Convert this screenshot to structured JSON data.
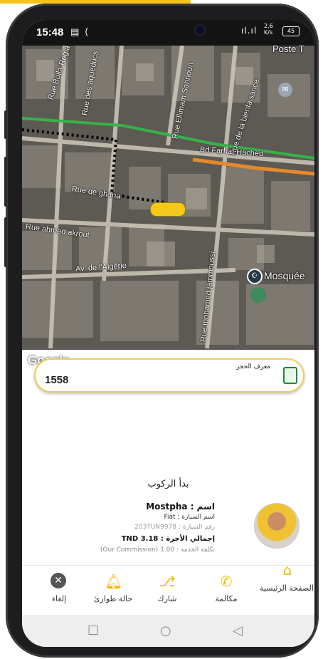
{
  "status_bar": {
    "time": "15:48",
    "signal": "ıl.ıl",
    "speed_value": "2,6",
    "speed_unit": "K/s",
    "battery": "45"
  },
  "map": {
    "streets": [
      "Rue Bulla Regia",
      "Rue des aqueducs",
      "Rue Ellimam Sahnoun",
      "Rue de la bienfaisance",
      "Bd Farhat Hached",
      "Rue de ghana",
      "Rue ahmed akrout",
      "Av. de l'Algérie",
      "Rue mohamed jammoussi",
      "Mosquée",
      "Poste T"
    ],
    "attribution": "Google",
    "colors": {
      "route_green": "#36b24a",
      "route_orange": "#e58a2c",
      "path_dots": "#000000",
      "taxi": "#f4c81c"
    }
  },
  "booking": {
    "label": "معرف الحجز",
    "value": "1558",
    "icon": "id-card-icon"
  },
  "ride": {
    "title": "بدأ الركوب",
    "name_label": "اسم :",
    "name_value": "Mostpha",
    "car_label": "اسم السيارة :",
    "car_value": "Fiat",
    "plate_label": "رقم السيارة :",
    "plate_value": "203TUN9978",
    "fare_label": "إجمالي الأجرة :",
    "fare_value": "TND 3.18",
    "fee_label": "تكلفة الخدمة :",
    "fee_value": "1.00",
    "commission": "(Our Commission)"
  },
  "nav": {
    "items": [
      {
        "label": "إلغاء",
        "icon": "cancel-icon"
      },
      {
        "label": "حالة طوارئ",
        "icon": "bell-icon"
      },
      {
        "label": "شارك",
        "icon": "share-icon"
      },
      {
        "label": "مكالمة",
        "icon": "phone-icon"
      },
      {
        "label": "الصفحة الرئيسية",
        "icon": "home-icon"
      }
    ]
  },
  "android_nav": {
    "icons": [
      "recent-apps-icon",
      "home-circle-icon",
      "back-icon"
    ]
  }
}
